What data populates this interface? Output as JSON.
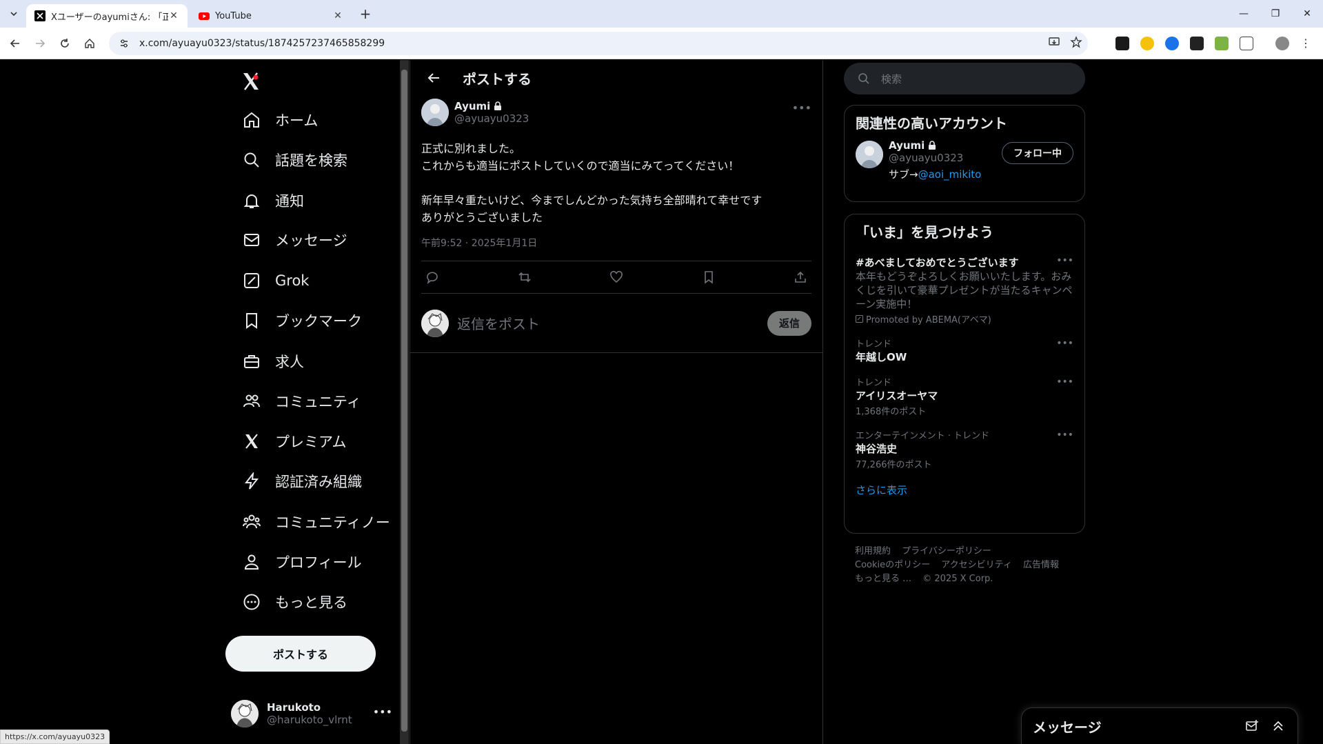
{
  "browser": {
    "tabs": [
      {
        "title": "Xユーザーのayumiさん: 「正式に別",
        "active": true
      },
      {
        "title": "YouTube",
        "active": false
      }
    ],
    "url": "x.com/ayuayu0323/status/1874257237465858299",
    "status_url": "https://x.com/ayuayu0323"
  },
  "nav": {
    "items": [
      {
        "label": "ホーム",
        "icon": "home-icon"
      },
      {
        "label": "話題を検索",
        "icon": "search-icon"
      },
      {
        "label": "通知",
        "icon": "bell-icon"
      },
      {
        "label": "メッセージ",
        "icon": "mail-icon"
      },
      {
        "label": "Grok",
        "icon": "grok-icon"
      },
      {
        "label": "ブックマーク",
        "icon": "bookmark-icon"
      },
      {
        "label": "求人",
        "icon": "briefcase-icon"
      },
      {
        "label": "コミュニティ",
        "icon": "communities-icon"
      },
      {
        "label": "プレミアム",
        "icon": "x-logo-icon"
      },
      {
        "label": "認証済み組織",
        "icon": "lightning-icon"
      },
      {
        "label": "コミュニティノー",
        "icon": "community-notes-icon"
      },
      {
        "label": "プロフィール",
        "icon": "person-icon"
      },
      {
        "label": "もっと見る",
        "icon": "more-circle-icon"
      }
    ],
    "post_button": "ポストする",
    "account": {
      "name": "Harukoto",
      "handle": "@harukoto_vlrnt"
    }
  },
  "main": {
    "title": "ポストする",
    "post": {
      "author_name": "Ayumi",
      "author_handle": "@ayuayu0323",
      "lines": [
        "正式に別れました。",
        "これからも適当にポストしていくので適当にみてってください！",
        "",
        "新年早々重たいけど、今までしんどかった気持ち全部晴れて幸せです",
        "ありがとうございました"
      ],
      "time": "午前9:52 · 2025年1月1日"
    },
    "reply": {
      "placeholder": "返信をポスト",
      "button": "返信"
    }
  },
  "side": {
    "search_placeholder": "検索",
    "who": {
      "title": "関連性の高いアカウント",
      "name": "Ayumi",
      "handle": "@ayuayu0323",
      "bio_prefix": "サブ→",
      "bio_link": "@aoi_mikito",
      "follow_label": "フォロー中"
    },
    "trends": {
      "title": "「いま」を見つけよう",
      "promo": {
        "title": "#あべましておめでとうございます",
        "desc": "本年もどうぞよろしくお願いいたします。おみくじを引いて豪華プレゼントが当たるキャンペーン実施中！",
        "promoted": "Promoted by ABEMA(アベマ)"
      },
      "items": [
        {
          "meta": "トレンド",
          "title": "年越しOW",
          "count": ""
        },
        {
          "meta": "トレンド",
          "title": "アイリスオーヤマ",
          "count": "1,368件のポスト"
        },
        {
          "meta": "エンターテインメント · トレンド",
          "title": "神谷浩史",
          "count": "77,266件のポスト"
        }
      ],
      "show_more": "さらに表示"
    },
    "footer": {
      "links": [
        "利用規約",
        "プライバシーポリシー",
        "Cookieのポリシー",
        "アクセシビリティ",
        "広告情報",
        "もっと見る …",
        "© 2025 X Corp."
      ]
    }
  },
  "messages_drawer": {
    "title": "メッセージ"
  },
  "colors": {
    "accent": "#1d9bf0",
    "background": "#000000",
    "text": "#e7e9ea",
    "muted": "#71767b"
  }
}
